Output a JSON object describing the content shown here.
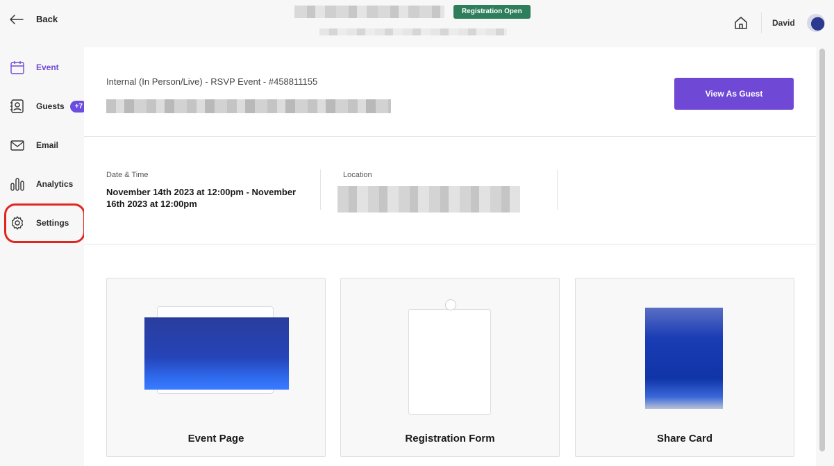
{
  "header": {
    "back_label": "Back",
    "status_badge": "Registration Open",
    "user_name": "David"
  },
  "sidebar": {
    "items": [
      {
        "label": "Event",
        "icon": "calendar-icon"
      },
      {
        "label": "Guests",
        "icon": "contacts-icon",
        "badge": "+7"
      },
      {
        "label": "Email",
        "icon": "mail-icon"
      },
      {
        "label": "Analytics",
        "icon": "bar-chart-icon"
      },
      {
        "label": "Settings",
        "icon": "gear-icon"
      }
    ]
  },
  "event": {
    "type_line": "Internal (In Person/Live) - RSVP Event - #458811155",
    "view_button": "View As Guest",
    "date_label": "Date & Time",
    "date_value": "November 14th 2023 at 12:00pm - November 16th 2023 at 12:00pm",
    "location_label": "Location"
  },
  "cards": [
    {
      "title": "Event Page"
    },
    {
      "title": "Registration Form"
    },
    {
      "title": "Share Card"
    }
  ],
  "colors": {
    "accent": "#7048d6",
    "status_green": "#2e7d5b",
    "highlight_red": "#e0271f"
  }
}
